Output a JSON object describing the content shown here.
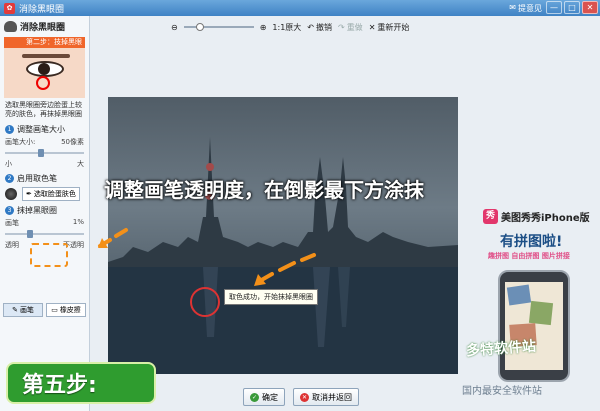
{
  "window": {
    "title": "消除黑眼圈",
    "feedback": "提意见",
    "btn_min": "—",
    "btn_max": "□",
    "btn_close": "✕"
  },
  "sidebar": {
    "header": "消除黑眼圈",
    "step_banner": "第二步：技掉黑眼圈",
    "description": "选取黑眼圈旁边脸蛋上较亮的肤色，再抹掉黑眼圈",
    "section1": {
      "num": "1",
      "title": "调整画笔大小",
      "label": "画笔大小:",
      "value": "50像素",
      "min": "小",
      "max": "大",
      "level": 0.45
    },
    "section2": {
      "num": "2",
      "title": "启用取色笔",
      "button": "选取脸蛋肤色"
    },
    "section3": {
      "num": "3",
      "title": "抹掉黑眼圈",
      "label": "画笔",
      "value": "1%",
      "min": "透明",
      "max": "不透明",
      "level": 0.3
    },
    "tools": {
      "brush": "画笔",
      "eraser": "橡皮擦"
    }
  },
  "toolbar": {
    "zoom_level": 0.2,
    "original_size": "1:1原大",
    "undo": "撤销",
    "redo": "重做",
    "reset": "重新开始"
  },
  "canvas": {
    "instruction": "调整画笔透明度，在倒影最下方涂抹",
    "tooltip": "取色成功，开始抹掉黑眼圈"
  },
  "ad": {
    "logo": "秀",
    "brand": "美图秀秀iPhone版",
    "headline": "有拼图啦!",
    "sub": "趣拼图 自由拼图 图片拼接"
  },
  "step_overlay": "第五步:",
  "watermark": "多特软件站",
  "watermark2": "国内最安全软件站",
  "bottom": {
    "ok": "确定",
    "cancel": "取消并返回"
  },
  "colors": {
    "accent": "#f39019",
    "brand_blue": "#3f82c4",
    "step_green": "#2f9c2f"
  }
}
